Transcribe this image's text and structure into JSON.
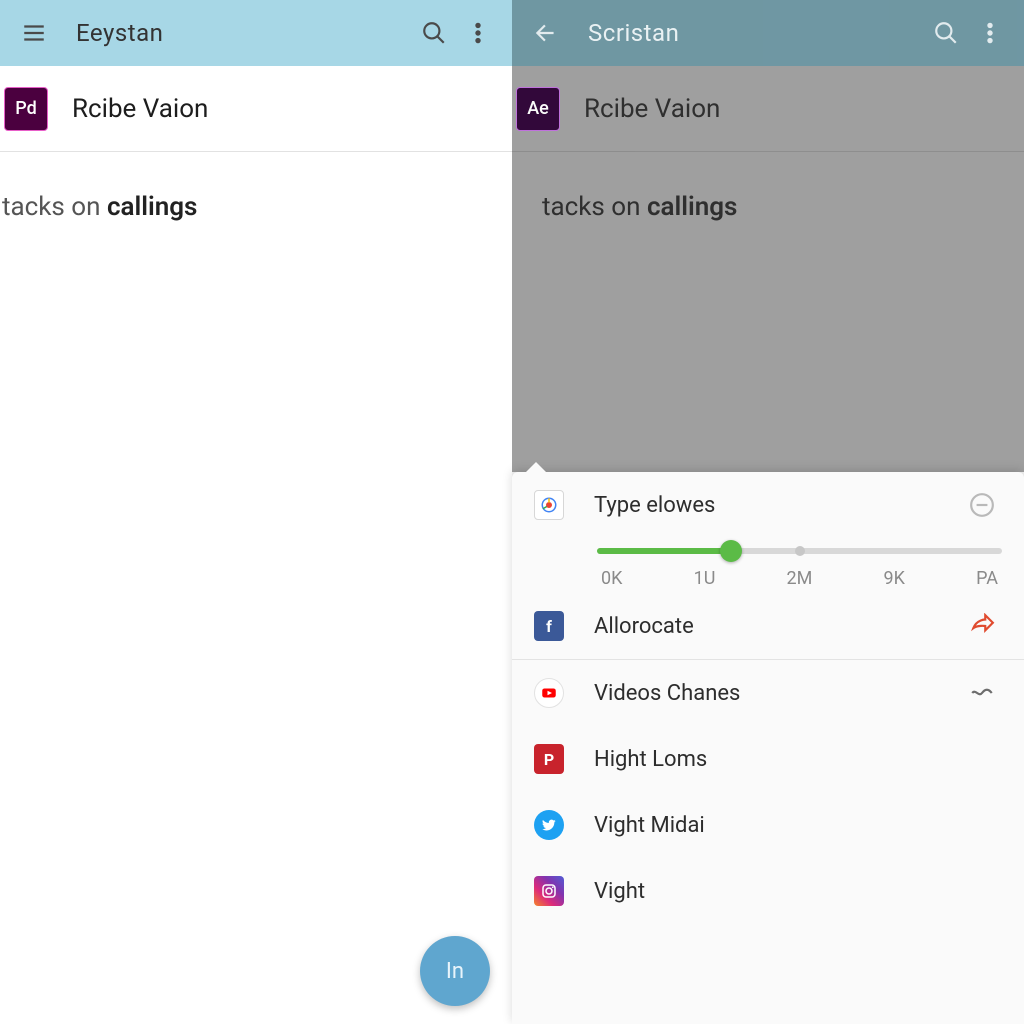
{
  "left": {
    "title": "Eeystan",
    "app_icon": "Pd",
    "app_name": "Rcibe Vaion",
    "body_plain": "tacks on ",
    "body_bold": "callings",
    "fab_label": "In"
  },
  "right": {
    "title": "Scristan",
    "app_icon": "Ae",
    "app_name": "Rcibe Vaion",
    "body_plain": "tacks on ",
    "body_bold": "callings"
  },
  "sheet": {
    "type_label": "Type elowes",
    "slider": {
      "value_pct": 33,
      "secondary_pct": 50,
      "ticks": [
        "0K",
        "1U",
        "2M",
        "9K",
        "PA"
      ]
    },
    "rows": [
      {
        "id": "allocate",
        "label": "Allorocate",
        "trail_icon": "share-arrow"
      },
      {
        "id": "videos",
        "label": "Videos Chanes",
        "trail_icon": "wave"
      },
      {
        "id": "hight",
        "label": "Hight Loms"
      },
      {
        "id": "vightm",
        "label": "Vight Midai"
      },
      {
        "id": "vight",
        "label": "Vight"
      }
    ]
  },
  "icons": {
    "left_menu": "hamburger-icon",
    "back": "back-arrow-icon",
    "search": "search-icon",
    "overflow": "more-vert-icon",
    "sheet_type": "chrome-icon",
    "sheet_minus": "minus-circle-icon"
  }
}
